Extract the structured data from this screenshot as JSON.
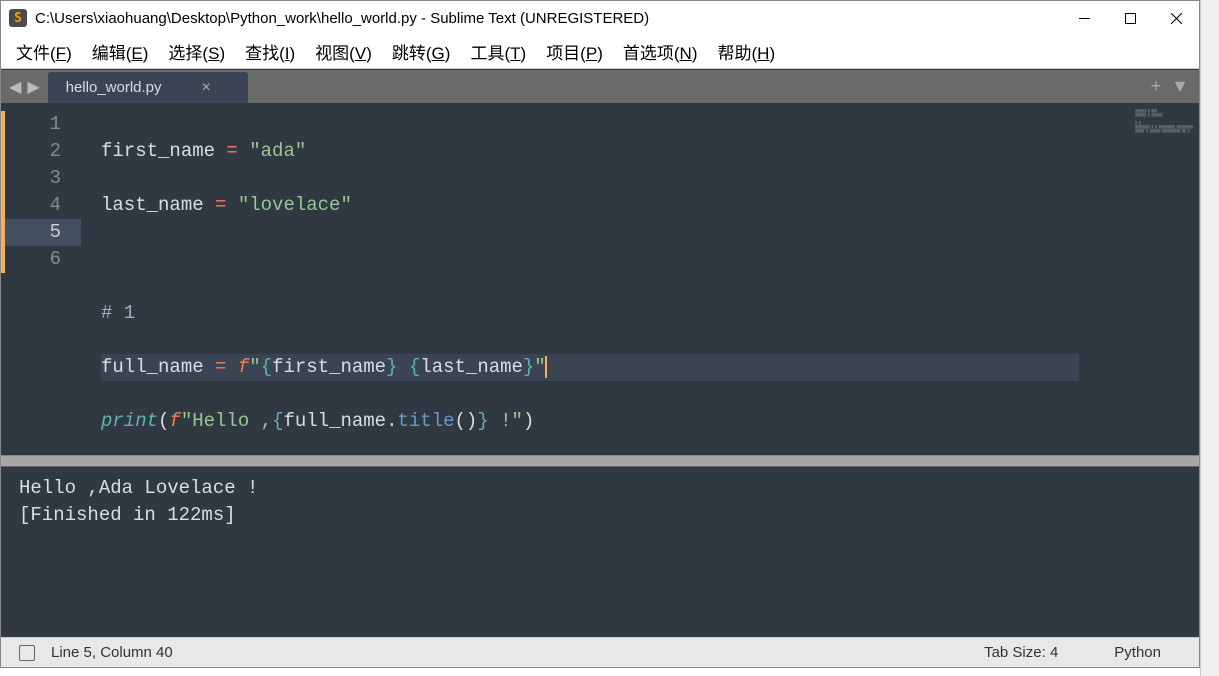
{
  "titlebar": {
    "icon_letter": "S",
    "title": "C:\\Users\\xiaohuang\\Desktop\\Python_work\\hello_world.py - Sublime Text (UNREGISTERED)"
  },
  "menu": {
    "file": "文件(F)",
    "edit": "编辑(E)",
    "select": "选择(S)",
    "find": "查找(I)",
    "view": "视图(V)",
    "goto": "跳转(G)",
    "tools": "工具(T)",
    "project": "项目(P)",
    "prefs": "首选项(N)",
    "help": "帮助(H)"
  },
  "tab": {
    "name": "hello_world.py",
    "close": "×"
  },
  "code": {
    "lines": [
      "1",
      "2",
      "3",
      "4",
      "5",
      "6"
    ],
    "current_line": "5",
    "l1_var": "first_name",
    "l1_eq": " = ",
    "l1_str": "\"ada\"",
    "l2_var": "last_name",
    "l2_eq": " = ",
    "l2_str": "\"lovelace\"",
    "l4_cmt": "# 1",
    "l5_var": "full_name",
    "l5_eq": " = ",
    "l5_f": "f",
    "l5_q1": "\"",
    "l5_b1": "{",
    "l5_i1": "first_name",
    "l5_b2": "}",
    "l5_sp": " ",
    "l5_b3": "{",
    "l5_i2": "last_name",
    "l5_b4": "}",
    "l5_q2": "\"",
    "l6_fn": "print",
    "l6_p1": "(",
    "l6_f": "f",
    "l6_q1": "\"",
    "l6_s1": "Hello ,",
    "l6_b1": "{",
    "l6_i1": "full_name",
    "l6_dot": ".",
    "l6_m": "title",
    "l6_p2": "(",
    "l6_p3": ")",
    "l6_b2": "}",
    "l6_s2": " !",
    "l6_q2": "\"",
    "l6_p4": ")"
  },
  "output": {
    "line1": "Hello ,Ada Lovelace !",
    "line2": "[Finished in 122ms]"
  },
  "status": {
    "position": "Line 5, Column 40",
    "tabsize": "Tab Size: 4",
    "syntax": "Python"
  }
}
